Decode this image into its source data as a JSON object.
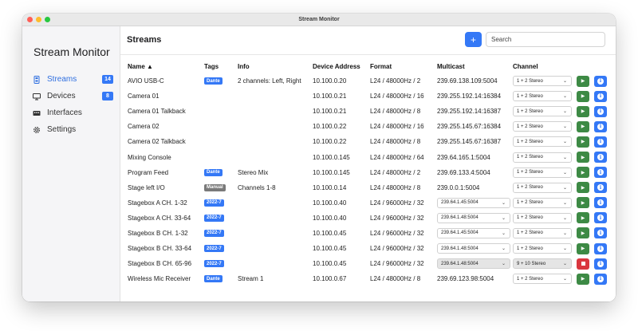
{
  "window": {
    "title": "Stream Monitor"
  },
  "sidebar": {
    "app_title": "Stream Monitor",
    "items": [
      {
        "label": "Streams",
        "icon": "streams-icon",
        "badge": "14",
        "active": true
      },
      {
        "label": "Devices",
        "icon": "devices-icon",
        "badge": "8",
        "active": false
      },
      {
        "label": "Interfaces",
        "icon": "interfaces-icon",
        "badge": "",
        "active": false
      },
      {
        "label": "Settings",
        "icon": "gear-icon",
        "badge": "",
        "active": false
      }
    ]
  },
  "header": {
    "title": "Streams",
    "add_label": "+",
    "search_placeholder": "Search"
  },
  "table": {
    "columns": {
      "name": "Name ▲",
      "tags": "Tags",
      "info": "Info",
      "address": "Device Address",
      "format": "Format",
      "multicast": "Multicast",
      "channel": "Channel"
    },
    "rows": [
      {
        "name": "AVIO USB-C",
        "tag": "Dante",
        "tag_type": "dante",
        "info": "2 channels: Left, Right",
        "address": "10.100.0.20",
        "format": "L24 / 48000Hz / 2",
        "multicast": "239.69.138.109:5004",
        "mc_select": false,
        "channel": "1 + 2 Stereo",
        "playing": false
      },
      {
        "name": "Camera 01",
        "tag": "",
        "tag_type": "",
        "info": "",
        "address": "10.100.0.21",
        "format": "L24 / 48000Hz / 16",
        "multicast": "239.255.192.14:16384",
        "mc_select": false,
        "channel": "1 + 2 Stereo",
        "playing": false
      },
      {
        "name": "Camera 01 Talkback",
        "tag": "",
        "tag_type": "",
        "info": "",
        "address": "10.100.0.21",
        "format": "L24 / 48000Hz / 8",
        "multicast": "239.255.192.14:16387",
        "mc_select": false,
        "channel": "1 + 2 Stereo",
        "playing": false
      },
      {
        "name": "Camera 02",
        "tag": "",
        "tag_type": "",
        "info": "",
        "address": "10.100.0.22",
        "format": "L24 / 48000Hz / 16",
        "multicast": "239.255.145.67:16384",
        "mc_select": false,
        "channel": "1 + 2 Stereo",
        "playing": false
      },
      {
        "name": "Camera 02 Talkback",
        "tag": "",
        "tag_type": "",
        "info": "",
        "address": "10.100.0.22",
        "format": "L24 / 48000Hz / 8",
        "multicast": "239.255.145.67:16387",
        "mc_select": false,
        "channel": "1 + 2 Stereo",
        "playing": false
      },
      {
        "name": "Mixing Console",
        "tag": "",
        "tag_type": "",
        "info": "",
        "address": "10.100.0.145",
        "format": "L24 / 48000Hz / 64",
        "multicast": "239.64.165.1:5004",
        "mc_select": false,
        "channel": "1 + 2 Stereo",
        "playing": false
      },
      {
        "name": "Program Feed",
        "tag": "Dante",
        "tag_type": "dante",
        "info": "Stereo Mix",
        "address": "10.100.0.145",
        "format": "L24 / 48000Hz / 2",
        "multicast": "239.69.133.4:5004",
        "mc_select": false,
        "channel": "1 + 2 Stereo",
        "playing": false
      },
      {
        "name": "Stage left I/O",
        "tag": "Manual",
        "tag_type": "manual",
        "info": "Channels 1-8",
        "address": "10.100.0.14",
        "format": "L24 / 48000Hz / 8",
        "multicast": "239.0.0.1:5004",
        "mc_select": false,
        "channel": "1 + 2 Stereo",
        "playing": false
      },
      {
        "name": "Stagebox A CH. 1-32",
        "tag": "2022-7",
        "tag_type": "dante",
        "info": "",
        "address": "10.100.0.40",
        "format": "L24 / 96000Hz / 32",
        "multicast": "239.64.1.45:5004",
        "mc_select": true,
        "channel": "1 + 2 Stereo",
        "playing": false
      },
      {
        "name": "Stagebox A CH. 33-64",
        "tag": "2022-7",
        "tag_type": "dante",
        "info": "",
        "address": "10.100.0.40",
        "format": "L24 / 96000Hz / 32",
        "multicast": "239.64.1.48:5004",
        "mc_select": true,
        "channel": "1 + 2 Stereo",
        "playing": false
      },
      {
        "name": "Stagebox B CH. 1-32",
        "tag": "2022-7",
        "tag_type": "dante",
        "info": "",
        "address": "10.100.0.45",
        "format": "L24 / 96000Hz / 32",
        "multicast": "239.64.1.45:5004",
        "mc_select": true,
        "channel": "1 + 2 Stereo",
        "playing": false
      },
      {
        "name": "Stagebox B CH. 33-64",
        "tag": "2022-7",
        "tag_type": "dante",
        "info": "",
        "address": "10.100.0.45",
        "format": "L24 / 96000Hz / 32",
        "multicast": "239.64.1.48:5004",
        "mc_select": true,
        "channel": "1 + 2 Stereo",
        "playing": false
      },
      {
        "name": "Stagebox B CH. 65-96",
        "tag": "2022-7",
        "tag_type": "dante",
        "info": "",
        "address": "10.100.0.45",
        "format": "L24 / 96000Hz / 32",
        "multicast": "239.64.1.48:5004",
        "mc_select": true,
        "channel": "9 + 10 Stereo",
        "playing": true
      },
      {
        "name": "Wireless Mic Receiver",
        "tag": "Dante",
        "tag_type": "dante",
        "info": "Stream 1",
        "address": "10.100.0.67",
        "format": "L24 / 48000Hz / 8",
        "multicast": "239.69.123.98:5004",
        "mc_select": false,
        "channel": "1 + 2 Stereo",
        "playing": false
      }
    ]
  },
  "colors": {
    "accent": "#3478f6",
    "play": "#3d8a45",
    "stop": "#d9363e",
    "manual": "#7a7a7a"
  }
}
